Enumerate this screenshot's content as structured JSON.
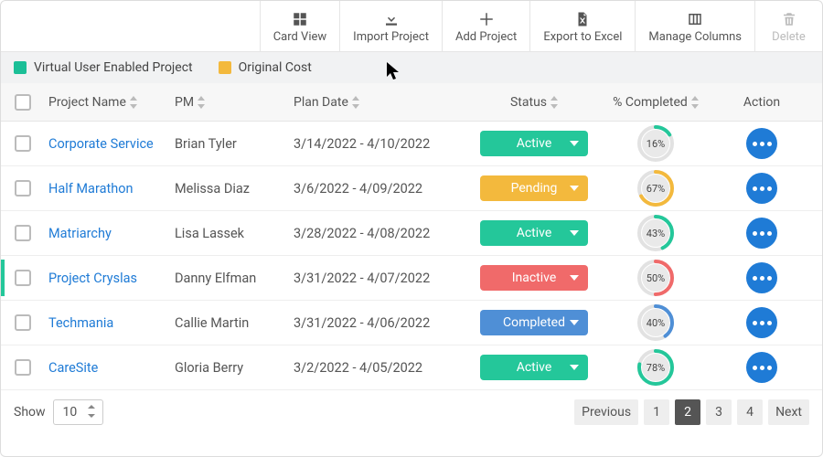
{
  "toolbar": {
    "card_view": "Card View",
    "import_project": "Import Project",
    "add_project": "Add Project",
    "export_excel": "Export to Excel",
    "manage_columns": "Manage Columns",
    "delete": "Delete"
  },
  "legend": {
    "virtual": {
      "label": "Virtual User Enabled Project",
      "color": "#1bbf97"
    },
    "original": {
      "label": "Original Cost",
      "color": "#f3b93d"
    }
  },
  "columns": {
    "name": "Project Name",
    "pm": "PM",
    "date": "Plan Date",
    "status": "Status",
    "pct": "% Completed",
    "action": "Action"
  },
  "status_colors": {
    "Active": "#24c79a",
    "Pending": "#f3b93d",
    "Inactive": "#f06a6a",
    "Completed": "#4f8fd6"
  },
  "rows": [
    {
      "name": "Corporate Service",
      "pm": "Brian Tyler",
      "date": "3/14/2022 - 4/10/2022",
      "status": "Active",
      "pct": 16,
      "highlight": false
    },
    {
      "name": "Half Marathon",
      "pm": "Melissa Diaz",
      "date": "3/6/2022 - 4/09/2022",
      "status": "Pending",
      "pct": 67,
      "highlight": false
    },
    {
      "name": "Matriarchy",
      "pm": "Lisa Lassek",
      "date": "3/28/2022 - 4/08/2022",
      "status": "Active",
      "pct": 43,
      "highlight": false
    },
    {
      "name": "Project Cryslas",
      "pm": "Danny Elfman",
      "date": "3/31/2022 - 4/07/2022",
      "status": "Inactive",
      "pct": 50,
      "highlight": true
    },
    {
      "name": "Techmania",
      "pm": "Callie Martin",
      "date": "3/31/2022 - 4/06/2022",
      "status": "Completed",
      "pct": 40,
      "highlight": false
    },
    {
      "name": "CareSite",
      "pm": "Gloria Berry",
      "date": "3/2/2022 - 4/05/2022",
      "status": "Active",
      "pct": 78,
      "highlight": false
    }
  ],
  "footer": {
    "show_label": "Show",
    "show_value": "10",
    "pager": {
      "prev": "Previous",
      "next": "Next",
      "pages": [
        "1",
        "2",
        "3",
        "4"
      ],
      "active": "2"
    }
  }
}
